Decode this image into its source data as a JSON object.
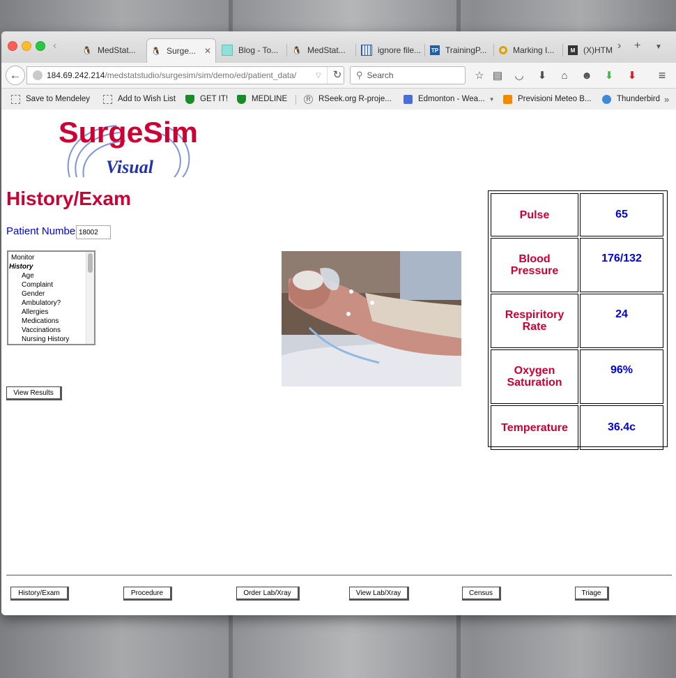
{
  "browser": {
    "tabs": [
      {
        "label": "MedStat...",
        "icon": "tux-icon",
        "active": false
      },
      {
        "label": "Surge...",
        "icon": "tux-icon",
        "active": true
      },
      {
        "label": "Blog - To...",
        "icon": "blog-icon",
        "active": false
      },
      {
        "label": "MedStat...",
        "icon": "tux-icon",
        "active": false
      },
      {
        "label": "ignore file...",
        "icon": "grid-icon",
        "active": false
      },
      {
        "label": "TrainingP...",
        "icon": "tp-icon",
        "active": false
      },
      {
        "label": "Marking I...",
        "icon": "ring-icon",
        "active": false
      },
      {
        "label": "(X)HTM",
        "icon": "mozilla-icon",
        "active": false
      }
    ],
    "url_host": "184.69.242.214",
    "url_path": "/medstatstudio/surgesim/sim/demo/ed/patient_data/",
    "search_placeholder": "Search",
    "bookmarks": [
      {
        "label": "Save to Mendeley",
        "icon": "dotted-box-icon"
      },
      {
        "label": "Add to Wish List",
        "icon": "dotted-box-icon"
      },
      {
        "label": "GET IT!",
        "icon": "shield-icon"
      },
      {
        "label": "MEDLINE",
        "icon": "shield-icon"
      },
      {
        "label": "RSeek.org R-proje...",
        "icon": "r-icon"
      },
      {
        "label": "Edmonton - Wea...",
        "icon": "rss-icon"
      },
      {
        "label": "Previsioni Meteo B...",
        "icon": "meteo-icon"
      },
      {
        "label": "Thunderbird",
        "icon": "thunderbird-icon"
      }
    ]
  },
  "logo": {
    "name": "SurgeSim",
    "subtitle": "Visual"
  },
  "page": {
    "title": "History/Exam",
    "patient_number_label": "Patient Number",
    "patient_number_value": "18002",
    "listbox_items": [
      {
        "label": "Monitor",
        "type": "item"
      },
      {
        "label": "History",
        "type": "group"
      },
      {
        "label": "Age",
        "type": "sub"
      },
      {
        "label": "Complaint",
        "type": "sub"
      },
      {
        "label": "Gender",
        "type": "sub"
      },
      {
        "label": "Ambulatory?",
        "type": "sub"
      },
      {
        "label": "Allergies",
        "type": "sub"
      },
      {
        "label": "Medications",
        "type": "sub"
      },
      {
        "label": "Vaccinations",
        "type": "sub"
      },
      {
        "label": "Nursing History",
        "type": "sub"
      }
    ],
    "view_results_label": "View Results"
  },
  "vitals": [
    {
      "label": "Pulse",
      "value": "65"
    },
    {
      "label": "Blood Pressure",
      "value": "176/132"
    },
    {
      "label": "Respiritory Rate",
      "value": "24"
    },
    {
      "label": "Oxygen Saturation",
      "value": "96%"
    },
    {
      "label": "Temperature",
      "value": "36.4c"
    }
  ],
  "bottom_nav": [
    {
      "label": "History/Exam"
    },
    {
      "label": "Procedure"
    },
    {
      "label": "Order Lab/Xray"
    },
    {
      "label": "View Lab/Xray"
    },
    {
      "label": "Census"
    },
    {
      "label": "Triage"
    }
  ],
  "colors": {
    "title_red": "#cc0033",
    "value_blue": "#0000dd",
    "link_blue": "#0000ee"
  }
}
